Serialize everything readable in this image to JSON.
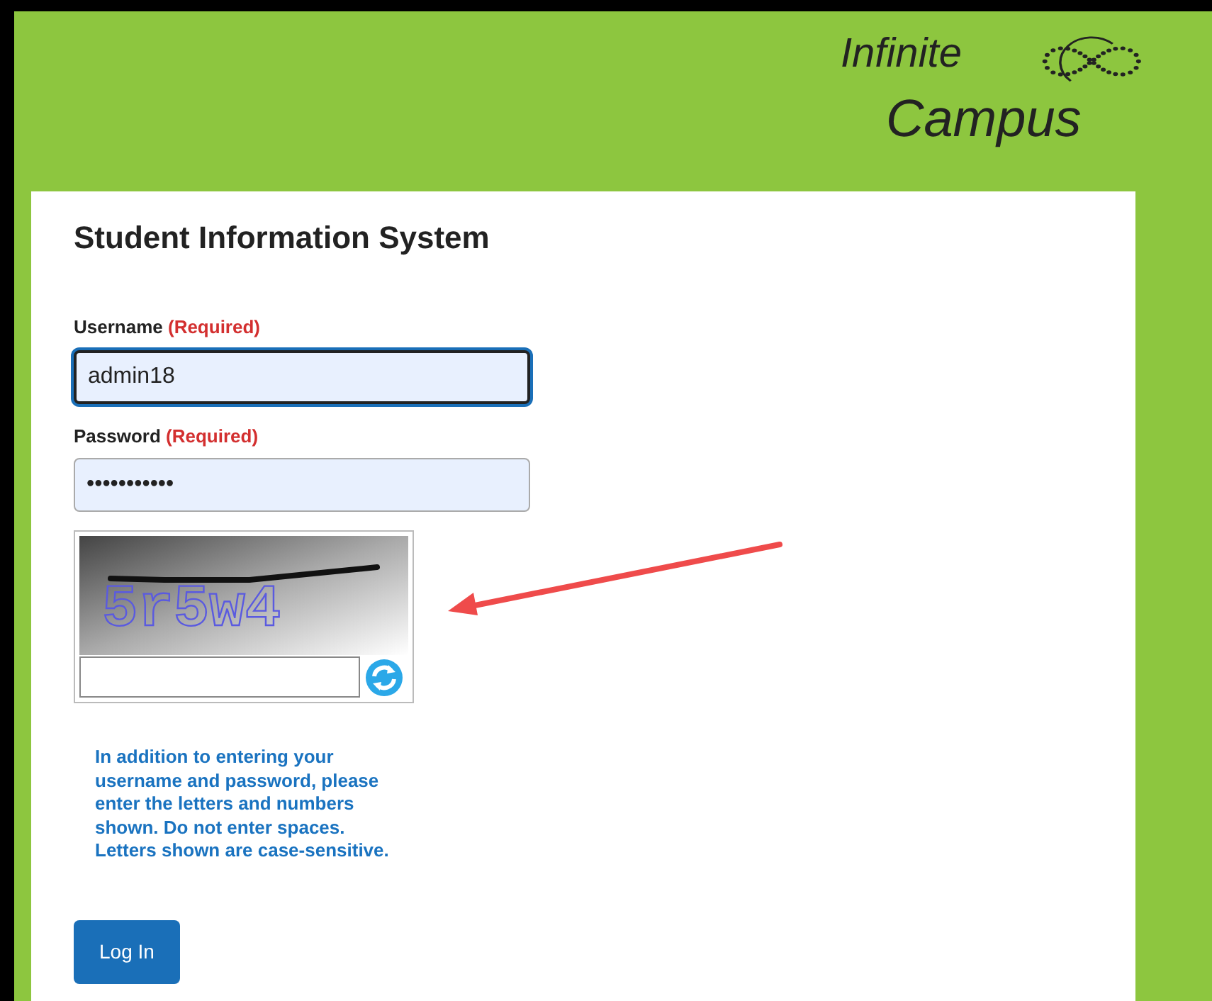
{
  "logo": {
    "line_1": "Infinite",
    "line_2": "Campus"
  },
  "title": "Student Information System",
  "fields": [
    {
      "label": "Username",
      "required": "(Required)",
      "value": "admin18",
      "focused": true
    },
    {
      "label": "Password",
      "required": "(Required)",
      "value": "•••••••••••",
      "focused": false
    }
  ],
  "captcha": {
    "text": "5r5w4"
  },
  "instructions": "In addition to entering your username and password, please enter the letters and numbers shown. Do not enter spaces. Letters shown are case-sensitive.",
  "login_button": "Log In",
  "annotation_arrow": true
}
